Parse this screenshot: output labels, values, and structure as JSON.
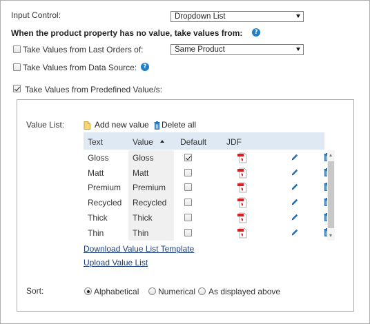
{
  "input_control": {
    "label": "Input Control:",
    "value": "Dropdown List"
  },
  "no_value_heading": "When the product property has no value, take values from:",
  "last_orders": {
    "label": "Take Values from Last Orders of:",
    "checked": false,
    "value": "Same Product"
  },
  "data_source": {
    "label": "Take Values from Data Source:",
    "checked": false
  },
  "predefined": {
    "label": "Take Values from Predefined Value/s:",
    "checked": true
  },
  "value_list": {
    "label": "Value List:",
    "add_label": "Add new value",
    "delete_label": "Delete all",
    "columns": {
      "text": "Text",
      "value": "Value",
      "default": "Default",
      "jdf": "JDF"
    },
    "rows": [
      {
        "text": "Gloss",
        "value": "Gloss",
        "default": true
      },
      {
        "text": "Matt",
        "value": "Matt",
        "default": false
      },
      {
        "text": "Premium",
        "value": "Premium",
        "default": false
      },
      {
        "text": "Recycled",
        "value": "Recycled",
        "default": false
      },
      {
        "text": "Thick",
        "value": "Thick",
        "default": false
      },
      {
        "text": "Thin",
        "value": "Thin",
        "default": false
      }
    ],
    "download_link": "Download Value List Template",
    "upload_link": "Upload Value List"
  },
  "sort": {
    "label": "Sort:",
    "options": [
      "Alphabetical",
      "Numerical",
      "As displayed above"
    ],
    "selected": "Alphabetical"
  },
  "colors": {
    "help": "#1f7fc8",
    "header": "#dfe9f3",
    "link": "#1a3f7a",
    "icon_blue": "#1f6fb8"
  }
}
